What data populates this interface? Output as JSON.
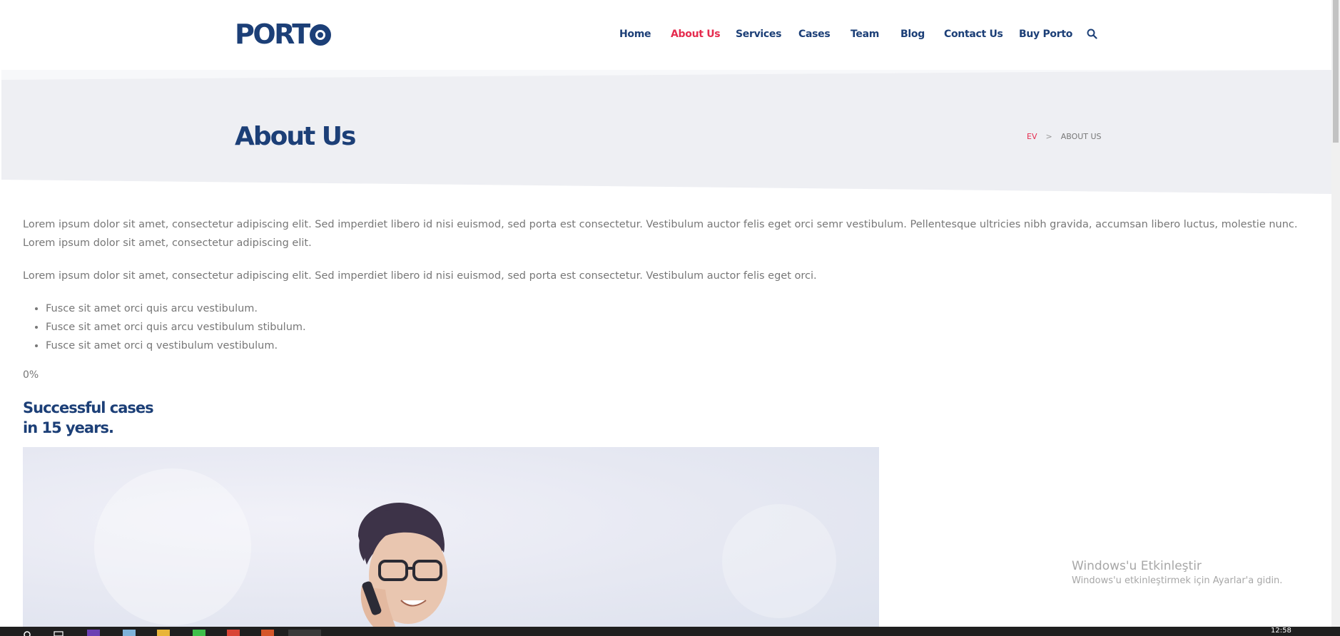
{
  "header": {
    "logo": "PORTO",
    "nav": [
      {
        "label": "Home",
        "active": false
      },
      {
        "label": "About Us",
        "active": true
      },
      {
        "label": "Services",
        "active": false
      },
      {
        "label": "Cases",
        "active": false
      },
      {
        "label": "Team",
        "active": false
      },
      {
        "label": "Blog",
        "active": false
      },
      {
        "label": "Contact Us",
        "active": false
      },
      {
        "label": "Buy Porto",
        "active": false
      }
    ],
    "search_icon": "search-icon"
  },
  "page_header": {
    "title": "About Us",
    "breadcrumb": {
      "home": "EV",
      "separator": ">",
      "current": "ABOUT US"
    }
  },
  "content": {
    "paragraphs": [
      "Lorem ipsum dolor sit amet, consectetur adipiscing elit. Sed imperdiet libero id nisi euismod, sed porta est consectetur. Vestibulum auctor felis eget orci semr vestibulum. Pellentesque ultricies nibh gravida, accumsan libero luctus, molestie nunc. Lorem ipsum dolor sit amet, consectetur adipiscing elit.",
      "Lorem ipsum dolor sit amet, consectetur adipiscing elit. Sed imperdiet libero id nisi euismod, sed porta est consectetur. Vestibulum auctor felis eget orci."
    ],
    "list": [
      "Fusce sit amet orci quis arcu vestibulum.",
      "Fusce sit amet orci quis arcu vestibulum stibulum.",
      "Fusce sit amet orci q vestibulum vestibulum."
    ],
    "percent": "0%",
    "cases_title_line1": "Successful cases",
    "cases_title_line2": "in 15 years."
  },
  "watermark": {
    "title": "Windows'u Etkinleştir",
    "subtitle": "Windows'u etkinleştirmek için Ayarlar'a gidin."
  },
  "taskbar": {
    "clock": "12:58"
  },
  "colors": {
    "brand": "#1c3f77",
    "accent": "#e52c4f",
    "band": "#eeeff3"
  }
}
